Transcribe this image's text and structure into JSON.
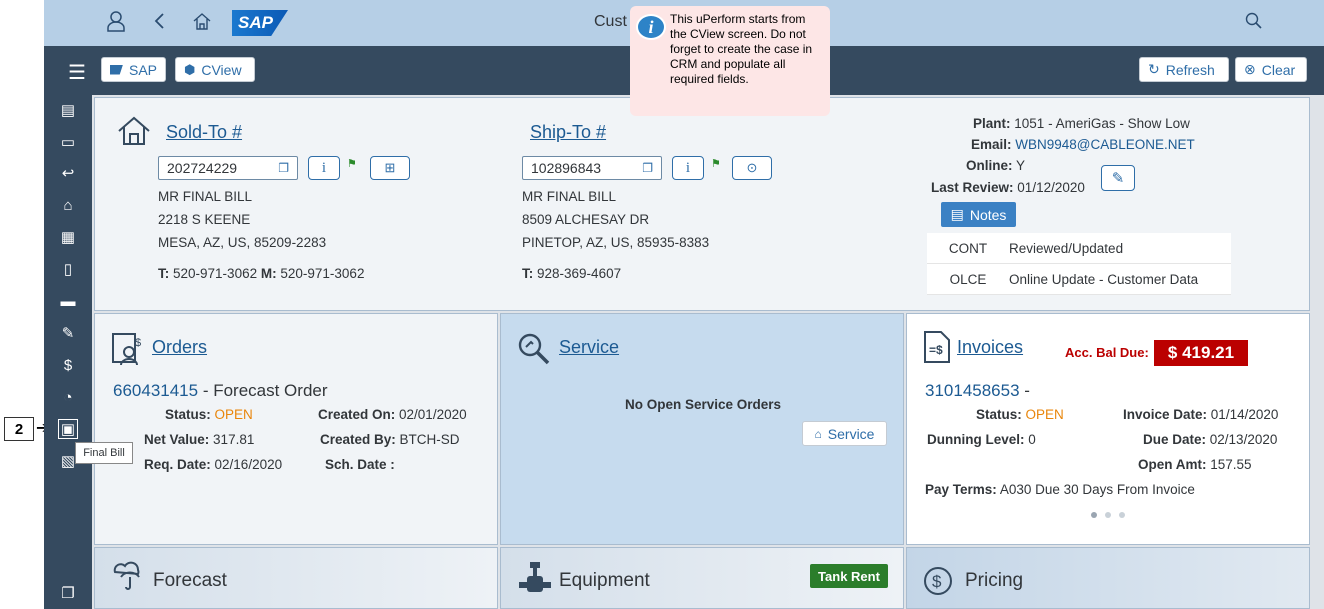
{
  "callout": {
    "step": "2"
  },
  "shell": {
    "title": "Cust"
  },
  "bubble": {
    "text": "This uPerform starts from the CView screen.  Do not forget to create the case in CRM and populate all required fields."
  },
  "toolbar": {
    "sap_label": "SAP",
    "cview_label": "CView",
    "refresh_label": "Refresh",
    "clear_label": "Clear"
  },
  "sidebar": {
    "tooltip": "Final Bill"
  },
  "sold_to": {
    "title": "Sold-To #",
    "number": "202724229",
    "name": "MR FINAL BILL",
    "street": "2218 S KEENE",
    "city": "MESA, AZ, US, 85209-2283",
    "phone_label": "T:",
    "phone": "520-971-3062",
    "mobile_label": "M:",
    "mobile": "520-971-3062"
  },
  "ship_to": {
    "title": "Ship-To #",
    "number": "102896843",
    "name": "MR FINAL BILL",
    "street": "8509 ALCHESAY DR",
    "city": "PINETOP, AZ, US, 85935-8383",
    "phone_label": "T:",
    "phone": "928-369-4607"
  },
  "account": {
    "plant_label": "Plant:",
    "plant": "1051 - AmeriGas - Show Low",
    "email_label": "Email:",
    "email": "WBN9948@CABLEONE.NET",
    "online_label": "Online:",
    "online": "Y",
    "review_label": "Last Review:",
    "review": "01/12/2020",
    "notes_label": "Notes",
    "notes": [
      {
        "code": "CONT",
        "desc": "Reviewed/Updated"
      },
      {
        "code": "OLCE",
        "desc": "Online Update - Customer Data"
      }
    ]
  },
  "orders": {
    "title": "Orders",
    "order_no": "660431415",
    "order_type": " - Forecast Order",
    "status_label": "Status:",
    "status": "OPEN",
    "created_on_label": "Created On:",
    "created_on": "02/01/2020",
    "net_label": "Net Value:",
    "net": "317.81",
    "created_by_label": "Created By:",
    "created_by": "BTCH-SD",
    "req_label": "Req. Date:",
    "req": "02/16/2020",
    "sch_label": "Sch. Date :"
  },
  "service": {
    "title": "Service",
    "empty": "No Open Service Orders",
    "button": "Service"
  },
  "invoices": {
    "title": "Invoices",
    "bal_label": "Acc. Bal Due:",
    "bal": "$ 419.21",
    "invoice_no": "3101458653",
    "invoice_suffix": " -",
    "status_label": "Status:",
    "status": "OPEN",
    "inv_date_label": "Invoice Date:",
    "inv_date": "01/14/2020",
    "dunning_label": "Dunning Level:",
    "dunning": "0",
    "due_label": "Due Date:",
    "due": "02/13/2020",
    "open_label": "Open Amt:",
    "open": "157.55",
    "terms_label": "Pay Terms:",
    "terms": "A030 Due 30 Days From Invoice"
  },
  "bottom": {
    "forecast": "Forecast",
    "equipment": "Equipment",
    "tank_rent": "Tank Rent",
    "pricing": "Pricing"
  },
  "colors": {
    "shell": "#b6cfe6",
    "toolbar": "#354a5f",
    "link": "#1c5a92",
    "balance": "#bb0000",
    "tank_rent": "#2b7d2b",
    "open": "#e9860b"
  }
}
